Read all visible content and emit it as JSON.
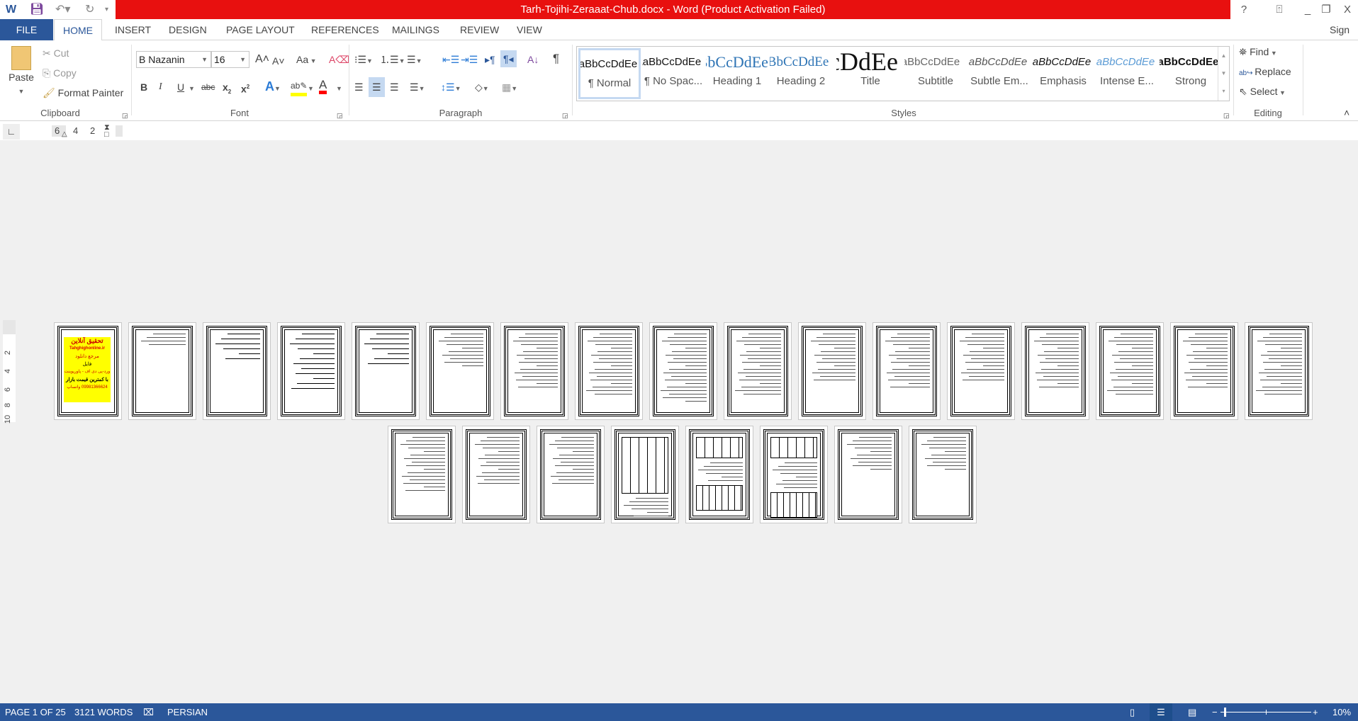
{
  "title_bar": {
    "title": "Tarh-Tojihi-Zeraaat-Chub.docx -  Word (Product Activation Failed)",
    "help": "?",
    "minimize": "_",
    "restore": "❐",
    "close": "X"
  },
  "tabs": [
    {
      "label": "FILE"
    },
    {
      "label": "HOME"
    },
    {
      "label": "INSERT"
    },
    {
      "label": "DESIGN"
    },
    {
      "label": "PAGE LAYOUT"
    },
    {
      "label": "REFERENCES"
    },
    {
      "label": "MAILINGS"
    },
    {
      "label": "REVIEW"
    },
    {
      "label": "VIEW"
    }
  ],
  "sign_in": "Sign in",
  "clipboard": {
    "paste": "Paste",
    "cut": "Cut",
    "copy": "Copy",
    "format_painter": "Format Painter",
    "label": "Clipboard"
  },
  "font": {
    "name": "B Nazanin",
    "size": "16",
    "label": "Font",
    "change_case": "Aa",
    "bold": "B",
    "italic": "I",
    "underline": "U",
    "strike": "abc",
    "highlight_color": "#ffff00",
    "font_color": "#ff0000"
  },
  "paragraph": {
    "label": "Paragraph"
  },
  "styles": {
    "label": "Styles",
    "items": [
      {
        "preview": "AaBbCcDdEe",
        "name": "¶ Normal"
      },
      {
        "preview": "AaBbCcDdEe",
        "name": "¶ No Spac..."
      },
      {
        "preview": "AaBbCcDdEe",
        "name": "Heading 1"
      },
      {
        "preview": "AaBbCcDdEe",
        "name": "Heading 2"
      },
      {
        "preview": "AaBbCcDdEe",
        "name": "Title"
      },
      {
        "preview": "AaBbCcDdEe",
        "name": "Subtitle"
      },
      {
        "preview": "AaBbCcDdEe",
        "name": "Subtle Em..."
      },
      {
        "preview": "AaBbCcDdEe",
        "name": "Emphasis"
      },
      {
        "preview": "AaBbCcDdEe",
        "name": "Intense E..."
      },
      {
        "preview": "AaBbCcDdEe",
        "name": "Strong"
      }
    ]
  },
  "editing": {
    "find": "Find",
    "replace": "Replace",
    "select": "Select",
    "label": "Editing"
  },
  "ruler": {
    "ticks": [
      "6",
      "4",
      "2"
    ],
    "vertical_ticks": [
      "2",
      "4",
      "6",
      "8",
      "10"
    ]
  },
  "cover_ad": {
    "lines": [
      "تحقیق آنلاین",
      "Tahghighonline.ir",
      "مرجع دانلود",
      "فایل",
      "ورد-پی دی اف - پاورپوینت",
      "با کمترین قیمت بازار",
      "09981366624 واتساپ"
    ]
  },
  "status": {
    "page": "PAGE 1 OF 25",
    "words": "3121 WORDS",
    "language": "PERSIAN",
    "zoom": "10%",
    "zoom_level_percent": 10
  },
  "colors": {
    "title_bar": "#e8100f",
    "accent": "#2b579a"
  }
}
